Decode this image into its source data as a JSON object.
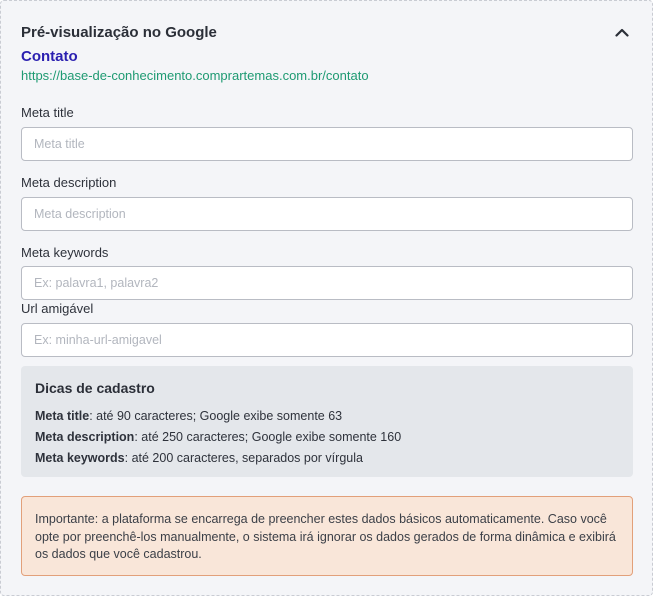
{
  "section": {
    "title": "Pré-visualização no Google",
    "collapse_icon": "chevron-up-icon"
  },
  "preview": {
    "title": "Contato",
    "url": "https://base-de-conhecimento.comprartemas.com.br/contato"
  },
  "fields": {
    "meta_title": {
      "label": "Meta title",
      "placeholder": "Meta title",
      "value": ""
    },
    "meta_description": {
      "label": "Meta description",
      "placeholder": "Meta description",
      "value": ""
    },
    "meta_keywords": {
      "label": "Meta keywords",
      "placeholder": "Ex: palavra1, palavra2",
      "value": ""
    },
    "friendly_url": {
      "label": "Url amigável",
      "placeholder": "Ex: minha-url-amigavel",
      "value": ""
    }
  },
  "tips": {
    "title": "Dicas de cadastro",
    "items": [
      {
        "term": "Meta title",
        "text": ": até 90 caracteres; Google exibe somente 63"
      },
      {
        "term": "Meta description",
        "text": ": até 250 caracteres; Google exibe somente 160"
      },
      {
        "term": "Meta keywords",
        "text": ": até 200 caracteres, separados por vírgula"
      }
    ]
  },
  "notice": {
    "text": "Importante: a plataforma se encarrega de preencher estes dados básicos automaticamente. Caso você opte por preenchê-los manualmente, o sistema irá ignorar os dados gerados de forma dinâmica e exibirá os dados que você cadastrou."
  },
  "colors": {
    "preview_title": "#2a1fb0",
    "preview_url": "#1e9a72",
    "notice_background": "#f9e6d9",
    "notice_border": "#e2a07a"
  }
}
